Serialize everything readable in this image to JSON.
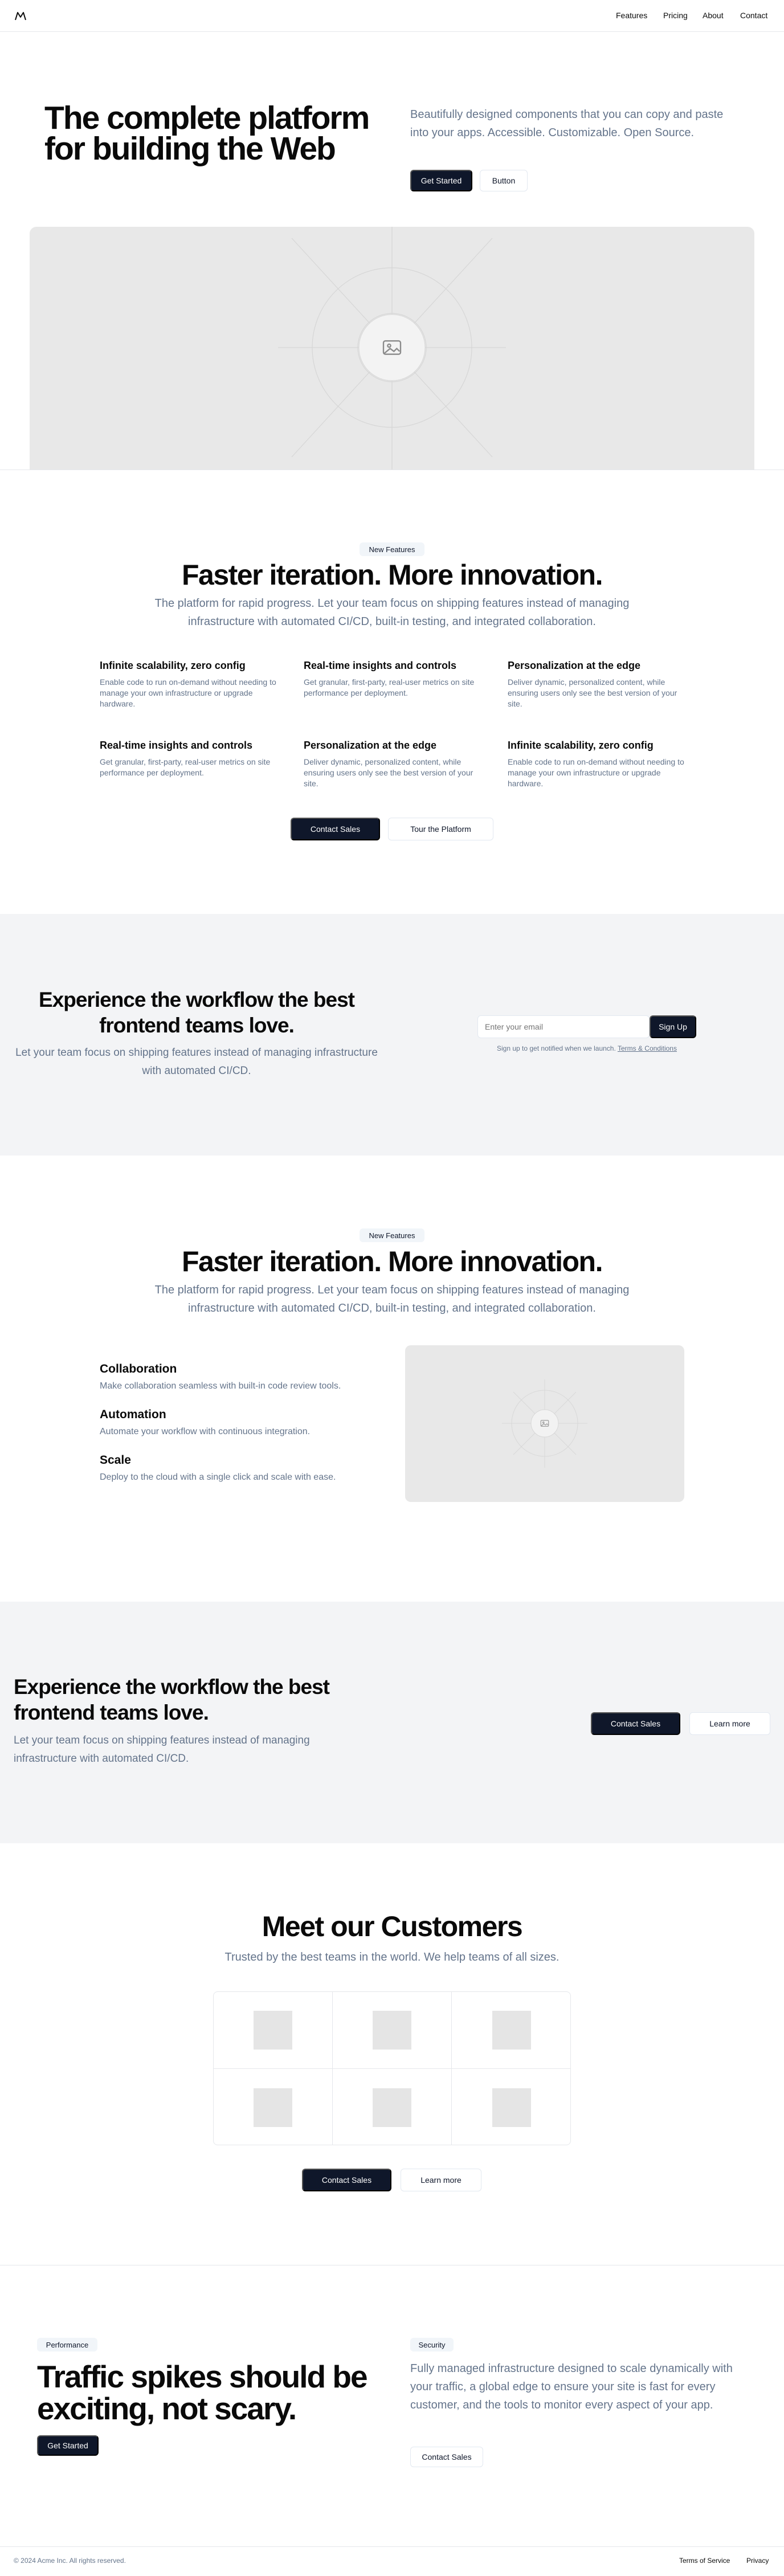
{
  "nav": {
    "links": [
      "Features",
      "Pricing",
      "About",
      "Contact"
    ]
  },
  "hero": {
    "title_line1": "The complete platform",
    "title_line2": "for building the Web",
    "description": "Beautifully designed components that you can copy and paste into your apps. Accessible. Customizable. Open Source.",
    "primary_button": "Get Started",
    "secondary_button": "Button"
  },
  "features1": {
    "badge": "New Features",
    "title": "Faster iteration. More innovation.",
    "subtitle": "The platform for rapid progress. Let your team focus on shipping features instead of managing infrastructure with automated CI/CD, built-in testing, and integrated collaboration.",
    "items": [
      {
        "title": "Infinite scalability, zero config",
        "desc": "Enable code to run on-demand without needing to manage your own infrastructure or upgrade hardware."
      },
      {
        "title": "Real-time insights and controls",
        "desc": "Get granular, first-party, real-user metrics on site performance per deployment."
      },
      {
        "title": "Personalization at the edge",
        "desc": "Deliver dynamic, personalized content, while ensuring users only see the best version of your site."
      },
      {
        "title": "Real-time insights and controls",
        "desc": "Get granular, first-party, real-user metrics on site performance per deployment."
      },
      {
        "title": "Personalization at the edge",
        "desc": "Deliver dynamic, personalized content, while ensuring users only see the best version of your site."
      },
      {
        "title": "Infinite scalability, zero config",
        "desc": "Enable code to run on-demand without needing to manage your own infrastructure or upgrade hardware."
      }
    ],
    "primary_button": "Contact Sales",
    "secondary_button": "Tour the Platform"
  },
  "signup": {
    "title_line1": "Experience the workflow the best",
    "title_line2": "frontend teams love.",
    "description": "Let your team focus on shipping features instead of managing infrastructure with automated CI/CD.",
    "email_placeholder": "Enter your email",
    "button": "Sign Up",
    "note": "Sign up to get notified when we launch.",
    "terms_link": "Terms & Conditions"
  },
  "features2": {
    "badge": "New Features",
    "title": "Faster iteration. More innovation.",
    "subtitle": "The platform for rapid progress. Let your team focus on shipping features instead of managing infrastructure with automated CI/CD, built-in testing, and integrated collaboration.",
    "items": [
      {
        "title": "Collaboration",
        "desc": "Make collaboration seamless with built-in code review tools."
      },
      {
        "title": "Automation",
        "desc": "Automate your workflow with continuous integration."
      },
      {
        "title": "Scale",
        "desc": "Deploy to the cloud with a single click and scale with ease."
      }
    ]
  },
  "cta": {
    "title_line1": "Experience the workflow the best",
    "title_line2": "frontend teams love.",
    "description": "Let your team focus on shipping features instead of managing infrastructure with automated CI/CD.",
    "primary_button": "Contact Sales",
    "secondary_button": "Learn more"
  },
  "customers": {
    "title": "Meet our Customers",
    "subtitle": "Trusted by the best teams in the world. We help teams of all sizes.",
    "primary_button": "Contact Sales",
    "secondary_button": "Learn more"
  },
  "traffic": {
    "badge_left": "Performance",
    "title_line1": "Traffic spikes should be",
    "title_line2": "exciting, not scary.",
    "primary_button": "Get Started",
    "badge_right": "Security",
    "description": "Fully managed infrastructure designed to scale dynamically with your traffic, a global edge to ensure your site is fast for every customer, and the tools to monitor every aspect of your app.",
    "secondary_button": "Contact Sales"
  },
  "footer": {
    "copyright": "© 2024 Acme Inc. All rights reserved.",
    "links": [
      "Terms of Service",
      "Privacy"
    ]
  }
}
